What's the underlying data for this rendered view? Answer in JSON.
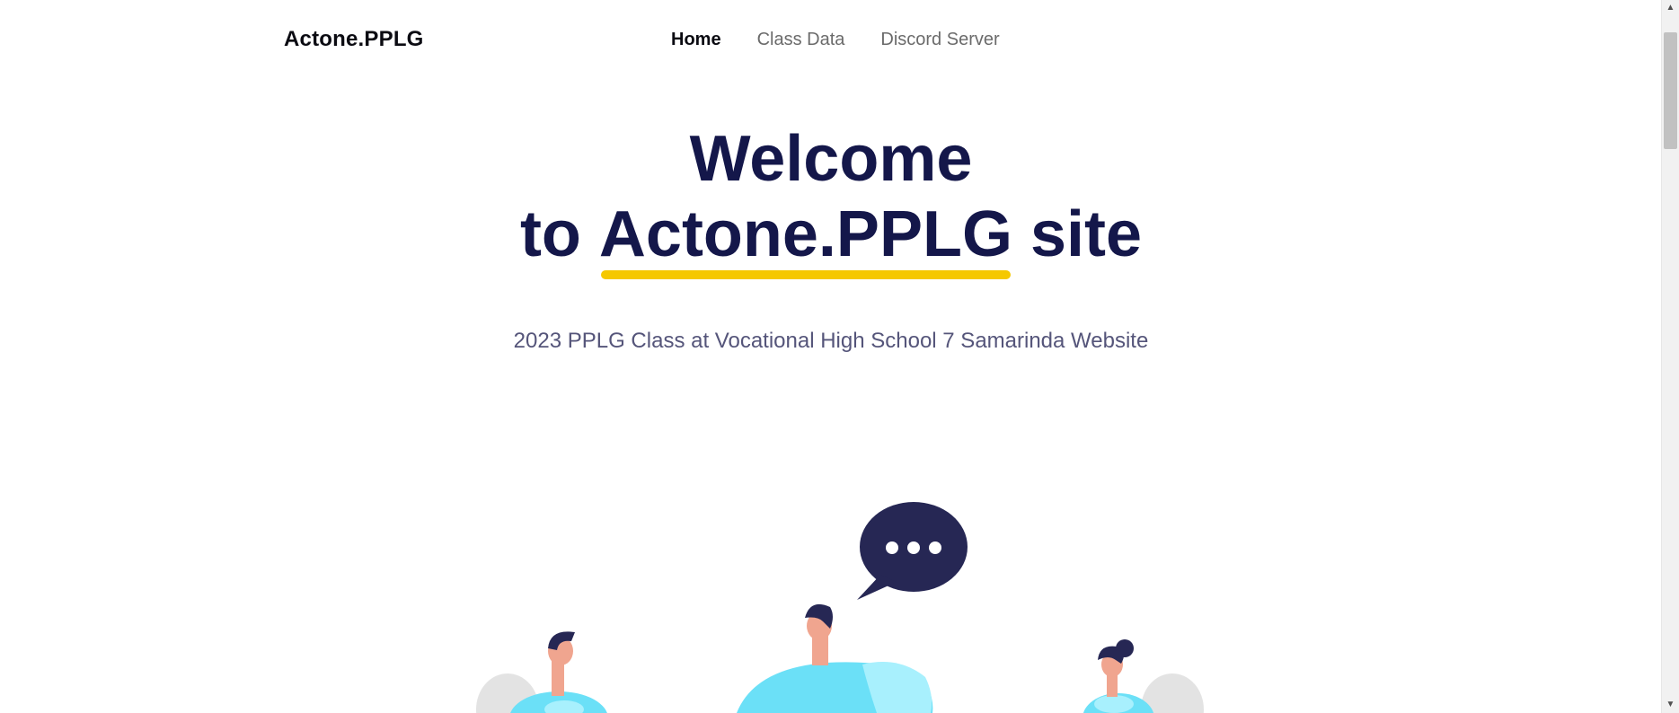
{
  "nav": {
    "brand": "Actone.PPLG",
    "items": [
      {
        "label": "Home",
        "active": true
      },
      {
        "label": "Class Data",
        "active": false
      },
      {
        "label": "Discord Server",
        "active": false
      }
    ]
  },
  "hero": {
    "line1": "Welcome",
    "line2_prefix": "to ",
    "line2_accent": "Actone.PPLG",
    "line2_suffix": " site",
    "subtitle": "2023 PPLG Class at Vocational High School 7 Samarinda Website"
  },
  "colors": {
    "title": "#14174a",
    "accent_underline": "#f5c800",
    "subtitle": "#55557a",
    "illustration_dark": "#262754",
    "illustration_light": "#6be0f7"
  },
  "icons": {
    "scroll_up": "scroll-up-arrow-icon",
    "scroll_down": "scroll-down-arrow-icon",
    "speech_bubble": "speech-bubble-icon"
  }
}
